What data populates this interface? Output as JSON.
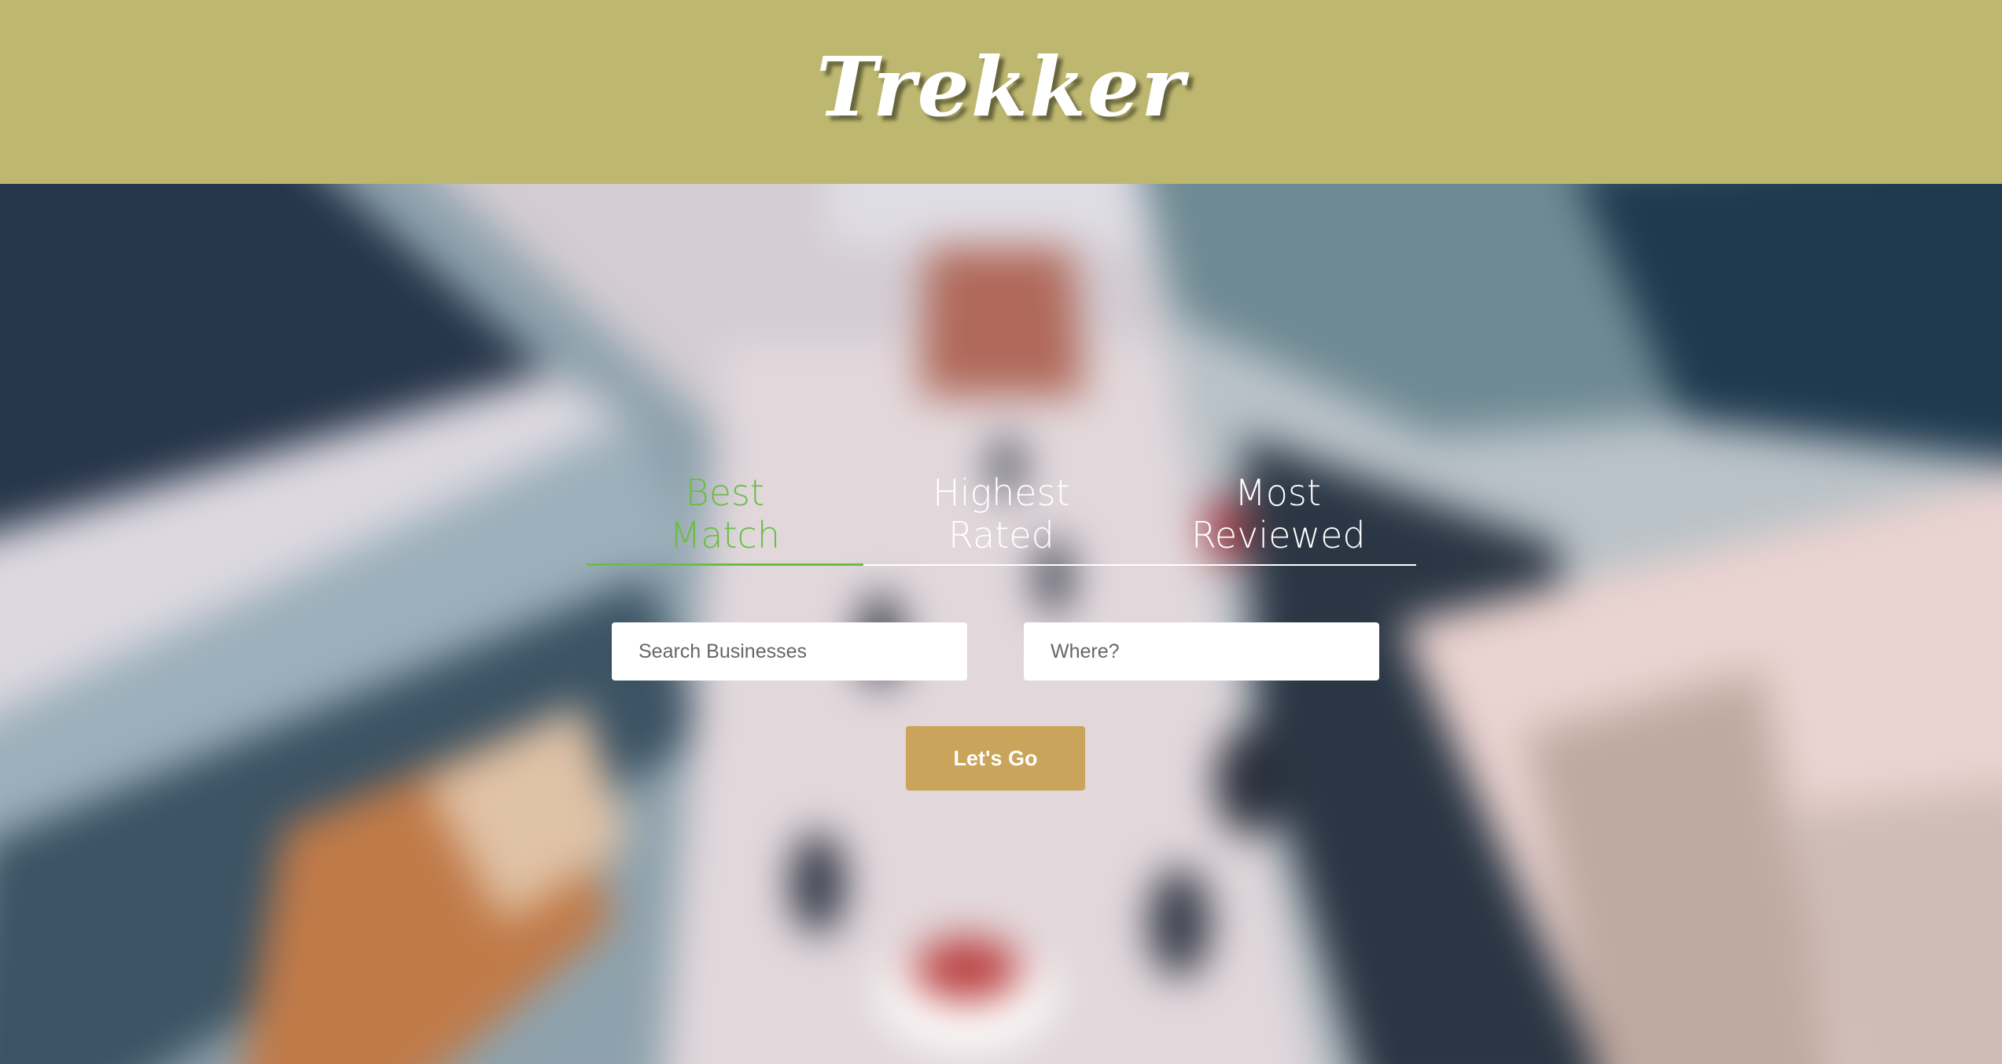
{
  "app": {
    "title": "Trekker",
    "header_color": "#bdb76f"
  },
  "sort_options": [
    {
      "label": "Best Match",
      "active": true
    },
    {
      "label": "Highest Rated",
      "active": false
    },
    {
      "label": "Most Reviewed",
      "active": false
    }
  ],
  "search": {
    "terms_placeholder": "Search Businesses",
    "location_placeholder": "Where?",
    "submit_label": "Let's Go"
  },
  "colors": {
    "active_tab": "#6bbd45",
    "submit_button": "#c9a45a"
  }
}
